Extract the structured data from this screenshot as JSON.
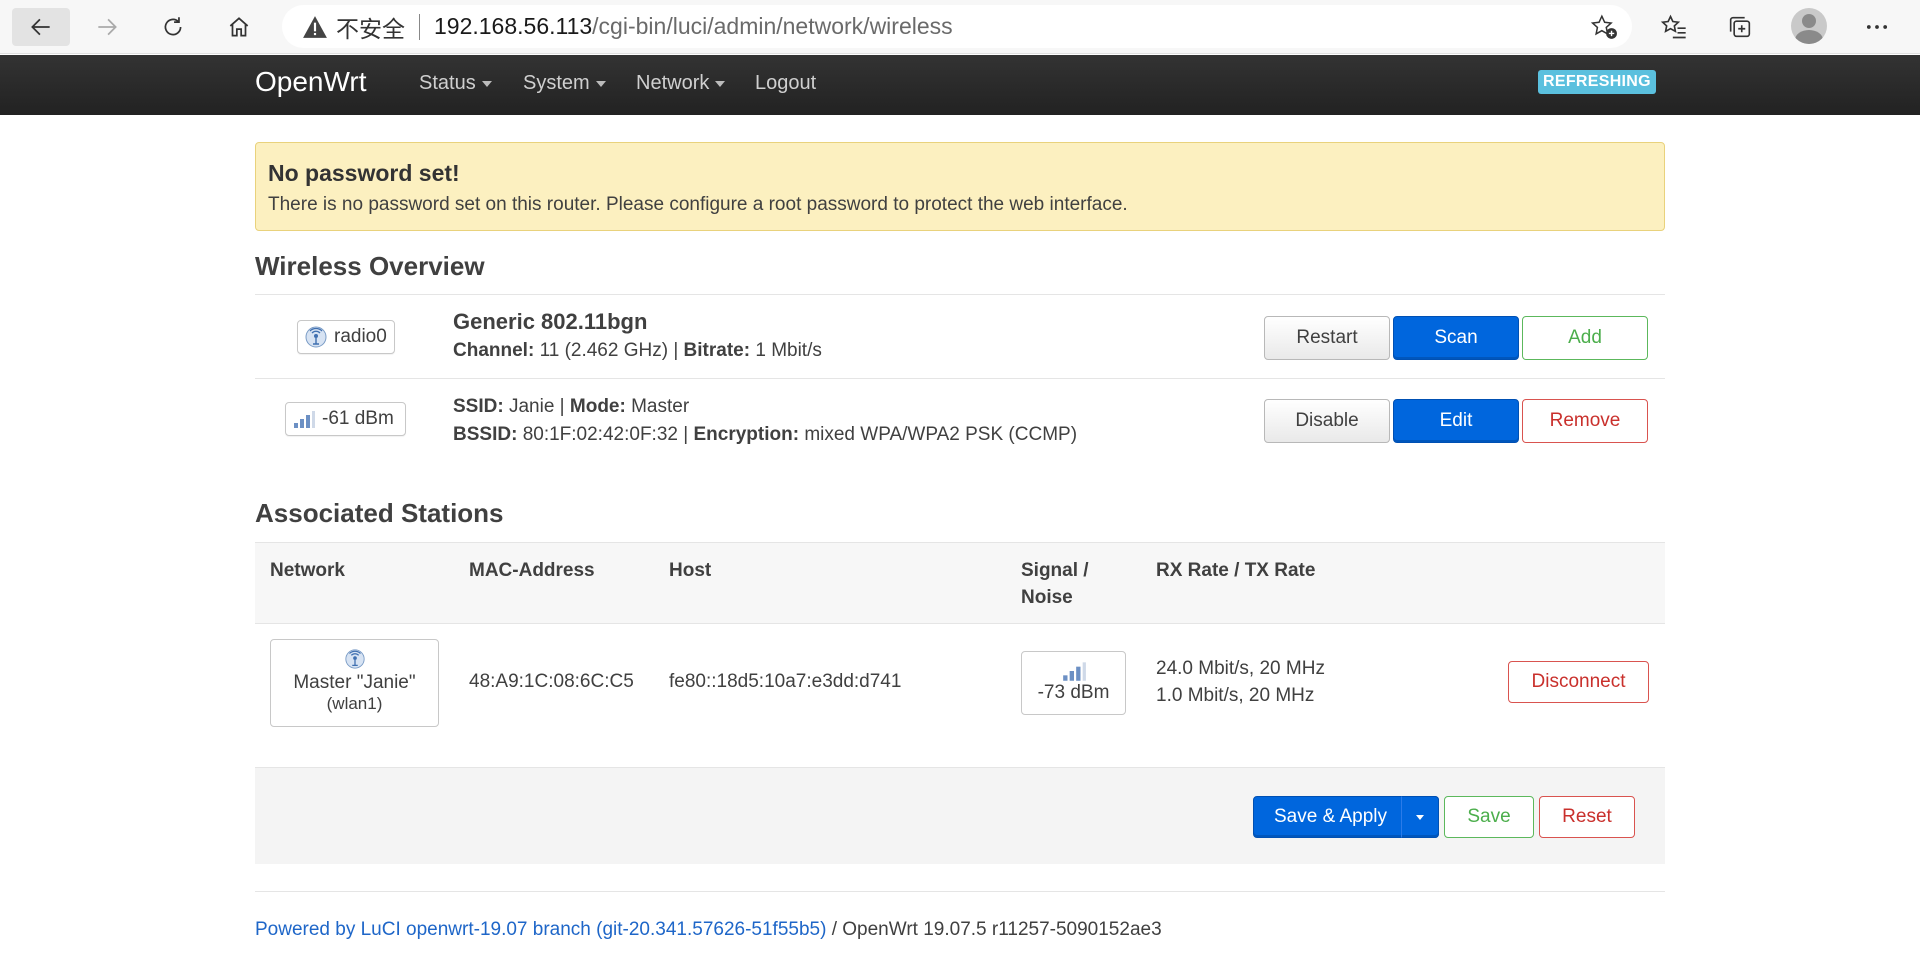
{
  "browser": {
    "insecure_label": "不安全",
    "url_host": "192.168.56.113",
    "url_path": "/cgi-bin/luci/admin/network/wireless"
  },
  "navbar": {
    "brand": "OpenWrt",
    "menu": [
      "Status",
      "System",
      "Network",
      "Logout"
    ],
    "status_badge": "REFRESHING"
  },
  "alert": {
    "title": "No password set!",
    "text": "There is no password set on this router. Please configure a root password to protect the web interface."
  },
  "wireless": {
    "title": "Wireless Overview",
    "radio": {
      "badge": "radio0",
      "name": "Generic 802.11bgn",
      "channel_label": "Channel:",
      "channel": "11 (2.462 GHz)",
      "bitrate_label": "Bitrate:",
      "bitrate": "1 Mbit/s",
      "buttons": [
        "Restart",
        "Scan",
        "Add"
      ]
    },
    "network": {
      "signal": "-61 dBm",
      "ssid_label": "SSID:",
      "ssid": "Janie",
      "mode_label": "Mode:",
      "mode": "Master",
      "bssid_label": "BSSID:",
      "bssid": "80:1F:02:42:0F:32",
      "encryption_label": "Encryption:",
      "encryption": "mixed WPA/WPA2 PSK (CCMP)",
      "buttons": [
        "Disable",
        "Edit",
        "Remove"
      ]
    }
  },
  "stations": {
    "title": "Associated Stations",
    "columns": [
      "Network",
      "MAC-Address",
      "Host",
      "Signal / Noise",
      "RX Rate / TX Rate"
    ],
    "rows": [
      {
        "network": "Master \"Janie\"",
        "iface": "(wlan1)",
        "mac": "48:A9:1C:08:6C:C5",
        "host": "fe80::18d5:10a7:e3dd:d741",
        "signal": "-73 dBm",
        "rx": "24.0 Mbit/s, 20 MHz",
        "tx": "1.0 Mbit/s, 20 MHz",
        "action": "Disconnect"
      }
    ]
  },
  "actions": {
    "save_apply": "Save & Apply",
    "save": "Save",
    "reset": "Reset"
  },
  "footer": {
    "link": "Powered by LuCI openwrt-19.07 branch (git-20.341.57626-51f55b5)",
    "version": " / OpenWrt 19.07.5 r11257-5090152ae3"
  },
  "colors": {
    "primary": "#0066dd",
    "success": "#4cae4c",
    "danger": "#c9302c",
    "alert_bg": "#fcf0c0",
    "navbar": "#222222",
    "refreshing": "#5bc0de"
  }
}
